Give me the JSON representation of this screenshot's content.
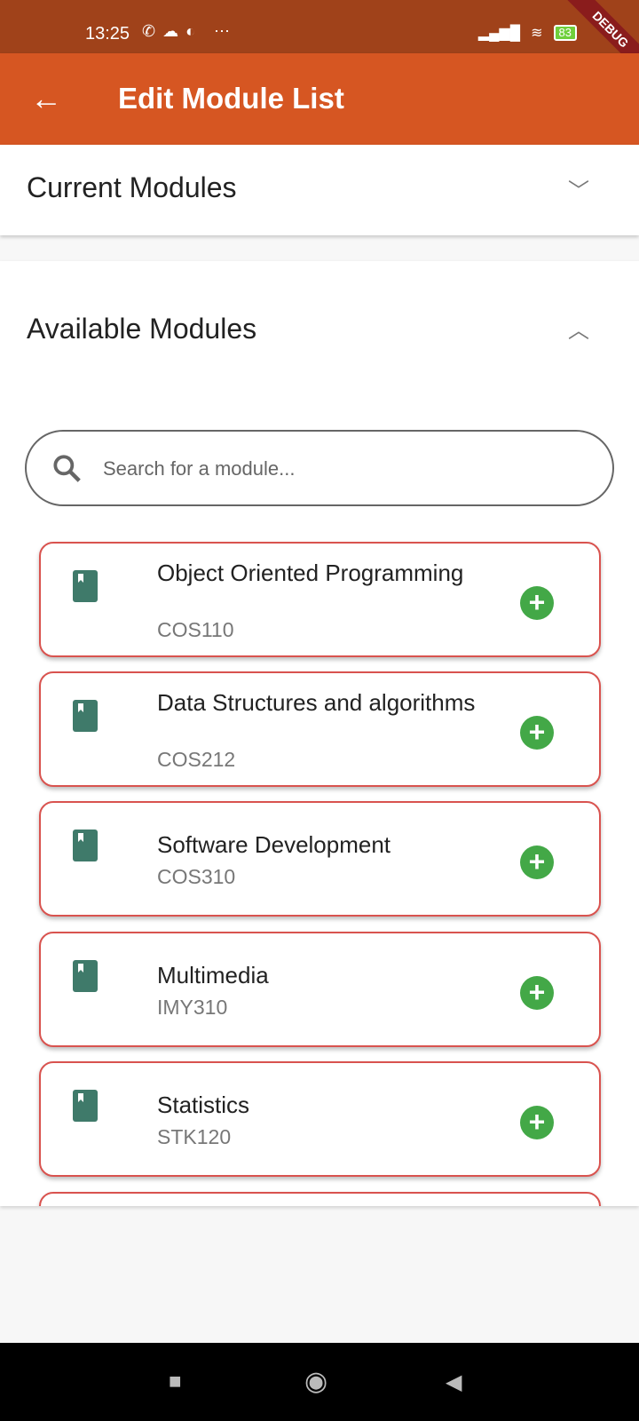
{
  "status_bar": {
    "time": "13:25",
    "battery": "83",
    "debug_banner": "DEBUG"
  },
  "app_bar": {
    "title": "Edit Module List"
  },
  "current_section": {
    "title": "Current Modules",
    "expanded": false
  },
  "available_section": {
    "title": "Available Modules",
    "expanded": true,
    "search": {
      "placeholder": "Search for a module...",
      "value": ""
    },
    "modules": [
      {
        "name": "Object Oriented Programming",
        "code": "COS110"
      },
      {
        "name": "Data Structures and algorithms",
        "code": "COS212"
      },
      {
        "name": "Software Development",
        "code": "COS310"
      },
      {
        "name": "Multimedia",
        "code": "IMY310"
      },
      {
        "name": "Statistics",
        "code": "STK120"
      }
    ]
  },
  "colors": {
    "app_bar": "#d65622",
    "card_border": "#d9534f",
    "add": "#43a847",
    "book": "#3f7a6a"
  }
}
